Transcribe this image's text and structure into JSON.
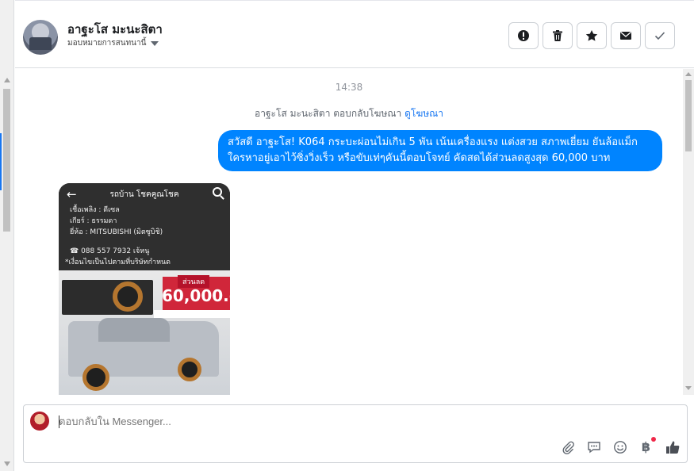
{
  "header": {
    "contact_name": "อาฐะโส มะนะสิตา",
    "assign_label": "มอบหมายการสนทนานี้",
    "actions": [
      {
        "name": "spam-button",
        "icon": "exclamation-icon"
      },
      {
        "name": "delete-button",
        "icon": "trash-icon"
      },
      {
        "name": "star-button",
        "icon": "star-icon"
      },
      {
        "name": "mark-unread-button",
        "icon": "envelope-icon"
      },
      {
        "name": "mark-done-button",
        "icon": "check-icon"
      }
    ]
  },
  "conversation": {
    "timestamp": "14:38",
    "reply_note": "อาฐะโส มะนะสิตา ตอบกลับโฆษณา",
    "view_ad_link": "ดูโฆษณา",
    "outgoing_message": "สวัสดี อาฐะโส! K064 กระบะผ่อนไม่เกิน 5 พัน เน้นเครื่องแรง แต่งสวย สภาพเยี่ยม ยันล้อแม็ก ใครหาอยู่เอาไว้ซิ่งวิ่งเร็ว หรือขับเท่ๆคันนี้ตอบโจทย์ คัดสดได้ส่วนลดสูงสุด 60,000 บาท"
  },
  "ad": {
    "title": "รถบ้าน โชคคูณโชค",
    "lines": [
      "เชื้อเพลิง : ดีเซล",
      "เกียร์ : ธรรมดา",
      "ยี่ห้อ : MITSUBISHI (มิตซูบิชิ)",
      "☎ 088 557 7932 เจ้หนู",
      "*เงื่อนไขเป็นไปตามที่บริษัทกำหนด"
    ],
    "discount_label": "ส่วนลด",
    "price": "60,000.-"
  },
  "composer": {
    "placeholder": "ตอบกลับใน Messenger...",
    "tools": [
      "paperclip-icon",
      "chat-bubble-icon",
      "smiley-icon",
      "baht-icon",
      "thumbs-up-icon"
    ],
    "baht_symbol": "฿"
  },
  "colors": {
    "accent": "#1877f2",
    "bubble": "#0084ff",
    "price_tag": "#d0263a",
    "notification_dot": "#f02849"
  }
}
